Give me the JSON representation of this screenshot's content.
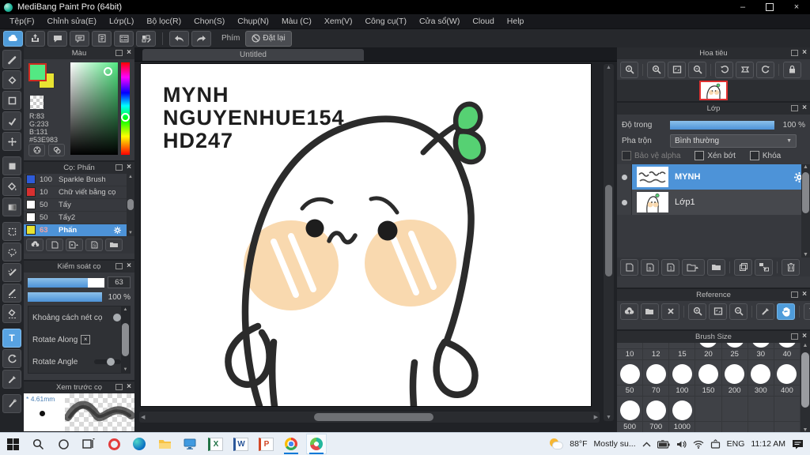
{
  "window": {
    "title": "MediBang Paint Pro (64bit)"
  },
  "menu": {
    "items": [
      "Tệp(F)",
      "Chỉnh sửa(E)",
      "Lớp(L)",
      "Bộ lọc(R)",
      "Chọn(S)",
      "Chụp(N)",
      "Màu (C)",
      "Xem(V)",
      "Công cụ(T)",
      "Cửa sổ(W)",
      "Cloud",
      "Help"
    ]
  },
  "toolbar": {
    "key_label": "Phím",
    "reset_label": "Đặt lại"
  },
  "canvas": {
    "tab": "Untitled",
    "text_lines": [
      "MYNH",
      "NGUYENHUE154",
      "HD247"
    ]
  },
  "color_panel": {
    "title": "Màu",
    "r": "R:83",
    "g": "G:233",
    "b": "B:131",
    "hex": "#53E983"
  },
  "brush_panel": {
    "title": "Cọ: Phấn",
    "brushes": [
      {
        "size": "100",
        "name": "Sparkle Brush",
        "color": "#2e5bd8"
      },
      {
        "size": "10",
        "name": "Chữ viết bằng cọ",
        "color": "#d83030"
      },
      {
        "size": "50",
        "name": "Tẩy",
        "color": "#ffffff"
      },
      {
        "size": "50",
        "name": "Tẩy2",
        "color": "#ffffff"
      },
      {
        "size": "63",
        "name": "Phấn",
        "color": "#e8e332"
      }
    ]
  },
  "brush_control_panel": {
    "title": "Kiểm soát cọ",
    "size_value": "63",
    "opacity_value": "100 %",
    "options": [
      "Khoảng cách nét cọ",
      "Rotate Along",
      "Rotate Angle"
    ]
  },
  "brush_preview_panel": {
    "title": "Xem trước cọ",
    "size_prefix": "*",
    "size_label": "4.61mm"
  },
  "navigator_panel": {
    "title": "Hoa tiêu"
  },
  "layer_panel": {
    "title": "Lớp",
    "opacity_label": "Độ trong",
    "opacity_value": "100 %",
    "blend_label": "Pha trộn",
    "blend_value": "Bình thường",
    "alpha_lock_label": "Bảo vệ alpha",
    "clipping_label": "Xén bớt",
    "lock_label": "Khóa",
    "layers": [
      {
        "name": "MYNH"
      },
      {
        "name": "Lớp1"
      }
    ]
  },
  "reference_panel": {
    "title": "Reference"
  },
  "brush_size_panel": {
    "title": "Brush Size",
    "sizes": [
      "10",
      "12",
      "15",
      "20",
      "25",
      "30",
      "40",
      "50",
      "70",
      "100",
      "150",
      "200",
      "300",
      "400",
      "500",
      "700",
      "1000"
    ]
  },
  "taskbar": {
    "weather_temp": "88°F",
    "weather_desc": "Mostly su...",
    "language": "ENG",
    "time": "11:12 AM"
  },
  "colors": {
    "accent_green": "#53E983",
    "selection_blue": "#4d93d8",
    "background_swatch": "#e8e332",
    "thumb_border_red": "#e03030",
    "taskbar_underline": "#0078d7"
  }
}
